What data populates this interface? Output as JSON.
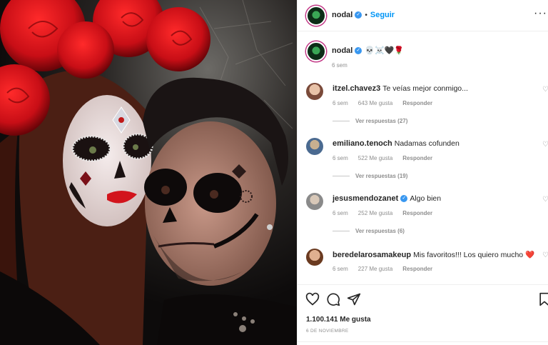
{
  "post": {
    "username": "nodal",
    "follow_label": "Seguir",
    "more_label": "···",
    "caption_emojis": "💀☠️🖤🌹",
    "caption_time": "6 sem",
    "likes": "1.100.141 Me gusta",
    "date": "6 DE NOVIEMBRE"
  },
  "comments": [
    {
      "user": "itzel.chavez3",
      "text": "Te veías mejor conmigo...",
      "time": "6 sem",
      "likes": "643 Me gusta",
      "reply": "Responder",
      "replies": "Ver respuestas (27)",
      "verified": false
    },
    {
      "user": "emiliano.tenoch",
      "text": "Nadamas cofunden",
      "time": "6 sem",
      "likes": "522 Me gusta",
      "reply": "Responder",
      "replies": "Ver respuestas (19)",
      "verified": false
    },
    {
      "user": "jesusmendozanet",
      "text": "Algo bien",
      "time": "6 sem",
      "likes": "252 Me gusta",
      "reply": "Responder",
      "replies": "Ver respuestas (6)",
      "verified": true
    },
    {
      "user": "beredelarosamakeup",
      "text": "Mis favoritos!!! Los quiero mucho",
      "time": "6 sem",
      "likes": "227 Me gusta",
      "reply": "Responder",
      "heart_emoji": "❤️",
      "verified": false
    }
  ],
  "icons": {
    "heart": "heart-icon",
    "comment": "comment-icon",
    "share": "share-icon",
    "save": "bookmark-icon"
  },
  "colors": {
    "follow": "#0095f6",
    "verified": "#3897f0",
    "muted": "#8e8e8e"
  }
}
